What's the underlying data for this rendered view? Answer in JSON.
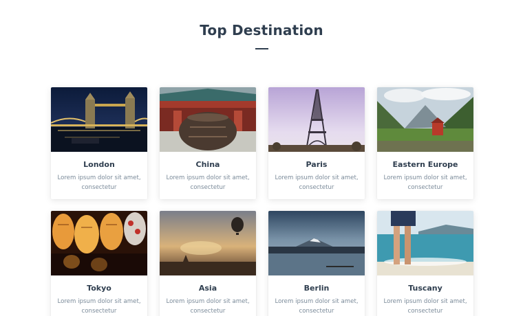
{
  "section": {
    "title": "Top Destination"
  },
  "destinations": [
    {
      "name": "London",
      "description": "Lorem ipsum dolor sit amet, consectetur",
      "image": "tower-bridge-night-photo"
    },
    {
      "name": "China",
      "description": "Lorem ipsum dolor sit amet, consectetur",
      "image": "chinese-temple-urn-photo"
    },
    {
      "name": "Paris",
      "description": "Lorem ipsum dolor sit amet, consectetur",
      "image": "eiffel-tower-photo"
    },
    {
      "name": "Eastern Europe",
      "description": "Lorem ipsum dolor sit amet, consectetur",
      "image": "mountain-valley-house-photo"
    },
    {
      "name": "Tokyo",
      "description": "Lorem ipsum dolor sit amet, consectetur",
      "image": "paper-lanterns-photo"
    },
    {
      "name": "Asia",
      "description": "Lorem ipsum dolor sit amet, consectetur",
      "image": "hot-air-balloon-sunset-photo"
    },
    {
      "name": "Berlin",
      "description": "Lorem ipsum dolor sit amet, consectetur",
      "image": "lake-mountain-photo"
    },
    {
      "name": "Tuscany",
      "description": "Lorem ipsum dolor sit amet, consectetur",
      "image": "beach-legs-photo"
    }
  ],
  "colors": {
    "heading": "#2f3e4f",
    "body_text": "#7a8a99",
    "background": "#ffffff"
  }
}
